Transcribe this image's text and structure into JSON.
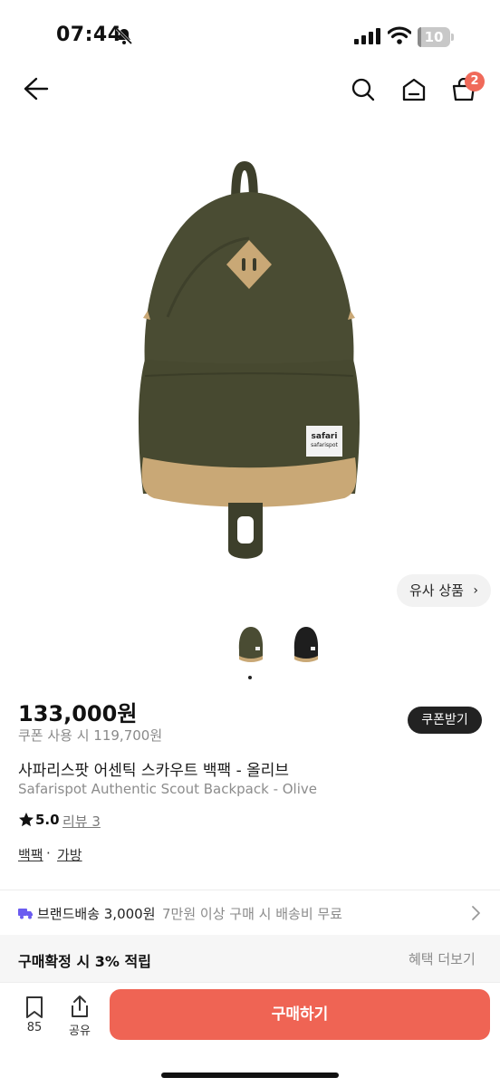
{
  "status_bar": {
    "time": "07:44",
    "battery": "10",
    "battery_level": 0.1
  },
  "header": {
    "cart_badge": "2"
  },
  "product": {
    "similar_button": "유사 상품",
    "similar_chevron": "›",
    "image_pages": 2,
    "active_image": 1,
    "label_text_1": "safari",
    "label_text_2": "safarispot",
    "price": "133,000원",
    "coupon_price": "쿠폰 사용 시 119,700원",
    "coupon_button": "쿠폰받기",
    "title_ko": "사파리스팟 어센틱 스카우트 백팩 - 올리브",
    "title_en": "Safarispot Authentic Scout Backpack - Olive",
    "rating": "5.0",
    "review_link": "리뷰 3",
    "category_1": "백팩",
    "category_separator": "·",
    "category_2": "가방"
  },
  "shipping": {
    "main": "브랜드배송 3,000원",
    "sub": "7만원 이상 구매 시 배송비 무료"
  },
  "reward": {
    "main": "구매확정 시 3% 적립",
    "more": "혜택 더보기"
  },
  "bottom_bar": {
    "bookmark_count": "85",
    "share_label": "공유",
    "buy_button": "구매하기"
  },
  "colors": {
    "accent": "#ef6454",
    "badge": "#f06a5a",
    "olive": "#4a4c33",
    "suede": "#c9a876"
  },
  "icons": [
    "bell-off-icon",
    "signal-icon",
    "wifi-icon",
    "battery-icon",
    "back-arrow-icon",
    "search-icon",
    "home-icon",
    "cart-icon",
    "chevron-right-icon",
    "star-icon",
    "truck-icon",
    "bookmark-icon",
    "share-icon"
  ]
}
